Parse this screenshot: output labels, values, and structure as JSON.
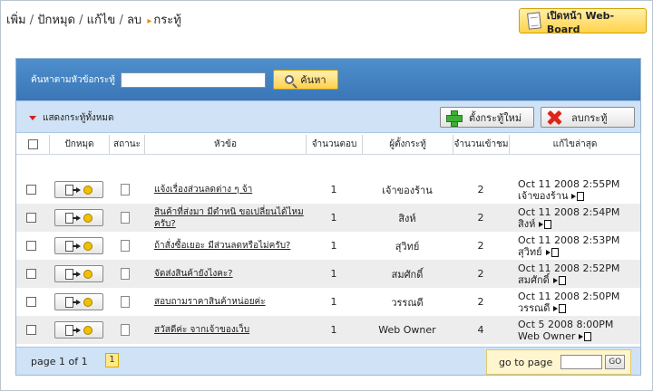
{
  "title": {
    "breadcrumb": [
      "เพิ่ม",
      "ปักหมุด",
      "แก้ไข",
      "ลบ"
    ],
    "current": "กระทู้"
  },
  "webboard_button": {
    "label": "เปิดหน้า Web-Board"
  },
  "search": {
    "label": "ค้นหาตามหัวข้อกระทู้",
    "input_value": "",
    "button_label": "ค้นหา"
  },
  "toolbar": {
    "show_all_label": "แสดงกระทู้ทั้งหมด",
    "new_topic_label": "ตั้งกระทู้ใหม่",
    "delete_topic_label": "ลบกระทู้"
  },
  "columns": {
    "pin": "ปักหมุด",
    "status": "สถานะ",
    "subject": "หัวข้อ",
    "replies": "จำนวนตอบ",
    "author": "ผู้ตั้งกระทู้",
    "views": "จำนวนเข้าชม",
    "last_edit": "แก้ไขล่าสุด"
  },
  "rows": [
    {
      "subject": "แจ้งเรื่องส่วนลดต่าง ๆ จ้า",
      "replies": "1",
      "author": "เจ้าของร้าน",
      "views": "2",
      "last_date": "Oct 11 2008 2:55PM",
      "last_by": "เจ้าของร้าน"
    },
    {
      "subject": "สินค้าที่ส่งมา มีตำหนิ ขอเปลี่ยนได้ไหมครับ?",
      "replies": "1",
      "author": "สิงห์",
      "views": "2",
      "last_date": "Oct 11 2008 2:54PM",
      "last_by": "สิงห์"
    },
    {
      "subject": "ถ้าสั่งซื้อเยอะ มีส่วนลดหรือไม่ครับ?",
      "replies": "1",
      "author": "สุวิทย์",
      "views": "2",
      "last_date": "Oct 11 2008 2:53PM",
      "last_by": "สุวิทย์"
    },
    {
      "subject": "จัดส่งสินค้ายังไงคะ?",
      "replies": "1",
      "author": "สมศักดิ์",
      "views": "2",
      "last_date": "Oct 11 2008 2:52PM",
      "last_by": "สมศักดิ์"
    },
    {
      "subject": "สอบถามราคาสินค้าหน่อยค่ะ",
      "replies": "1",
      "author": "วรรณดี",
      "views": "2",
      "last_date": "Oct 11 2008 2:50PM",
      "last_by": "วรรณดี"
    },
    {
      "subject": "สวัสดีค่ะ จากเจ้าของเว็บ",
      "replies": "1",
      "author": "Web Owner",
      "views": "4",
      "last_date": "Oct 5 2008 8:00PM",
      "last_by": "Web Owner"
    }
  ],
  "footer": {
    "page_info": "page 1 of 1",
    "page_number": "1",
    "goto_label": "go to page",
    "go_button": "GO"
  },
  "colors": {
    "search_bar": "#3f7cbd",
    "toolbar_bg": "#cfe2f6",
    "button_yellow": "#ffd24a",
    "row_alt": "#ededed"
  }
}
